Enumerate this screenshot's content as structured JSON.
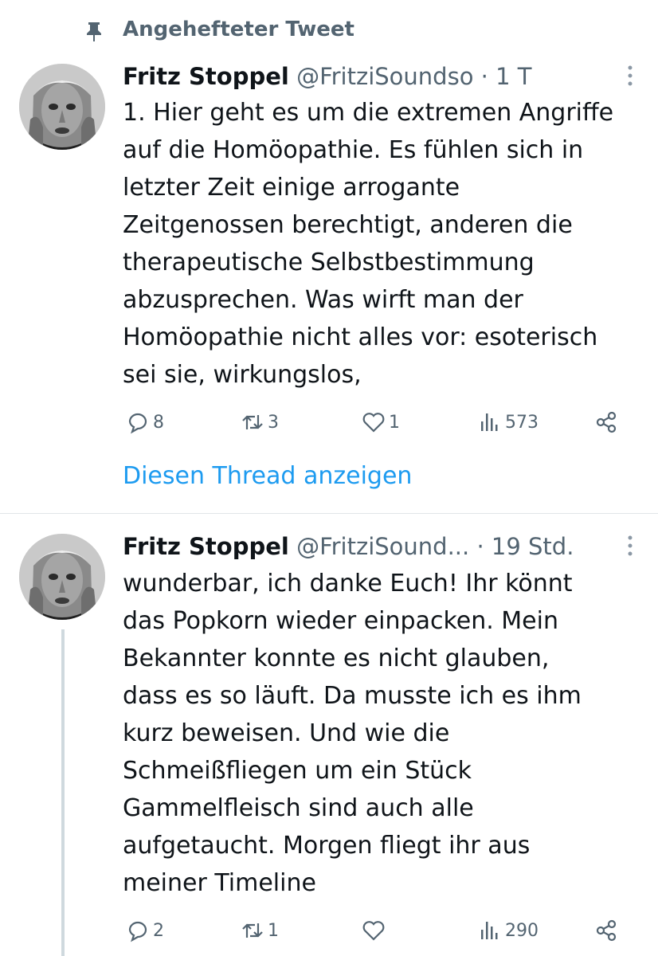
{
  "pinned": {
    "label": "Angehefteter Tweet",
    "icon": "pin-icon"
  },
  "tweets": [
    {
      "author_name": "Fritz Stoppel",
      "handle": "@FritziSoundso",
      "separator": "·",
      "time": "1 T",
      "text": "1. Hier geht es um die extremen Angriffe\nauf die Homöopathie. Es fühlen sich in\nletzter Zeit einige arrogante\nZeitgenossen berechtigt, anderen die\ntherapeutische Selbstbestimmung\nabzusprechen. Was wirft man der\nHomöopathie nicht alles vor: esoterisch\nsei sie, wirkungslos,",
      "replies": "8",
      "retweets": "3",
      "likes": "1",
      "views": "573",
      "show_thread": "Diesen Thread anzeigen"
    },
    {
      "author_name": "Fritz Stoppel",
      "handle": "@FritziSound...",
      "separator": "·",
      "time": "19 Std.",
      "text": "wunderbar, ich danke Euch! Ihr könnt\ndas Popkorn wieder einpacken. Mein\nBekannter konnte es nicht glauben,\ndass es so läuft. Da musste ich es ihm\nkurz beweisen. Und wie die\nSchmeißfliegen um ein Stück\nGammelfleisch sind auch alle\naufgetaucht. Morgen fliegt ihr aus\nmeiner Timeline",
      "replies": "2",
      "retweets": "1",
      "likes": "",
      "views": "290"
    }
  ],
  "colors": {
    "accent": "#1d9bf0",
    "muted": "#536471",
    "text": "#0f1419",
    "border": "#e1e5e8"
  }
}
